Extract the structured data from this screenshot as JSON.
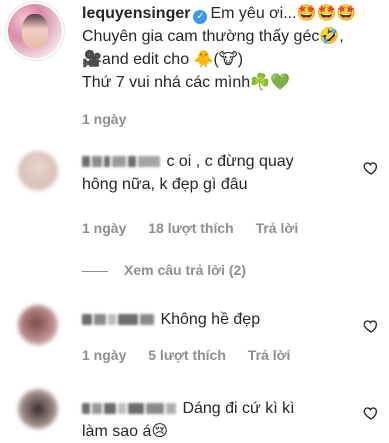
{
  "post": {
    "username": "lequyensinger",
    "caption_line1": "Em yêu ơi...🤩🤩🤩",
    "caption_line2": "Chuyên gia cam thường thấy géc🤣,",
    "caption_line3": "🎥and edit cho 🐥(🐮)",
    "caption_line4": "Thứ 7 vui nhá các mình☘️💚",
    "time": "1 ngày"
  },
  "comments": [
    {
      "text_line1": "c oi , c đừng quay",
      "text_line2": "hông nữa, k đẹp gì đâu",
      "time": "1 ngày",
      "likes": "18 lượt thích",
      "reply": "Trả lời",
      "view_replies": "Xem câu trả lời (2)"
    },
    {
      "text_line1": "Không hề đẹp",
      "time": "1 ngày",
      "likes": "5 lượt thích",
      "reply": "Trả lời"
    },
    {
      "text_line1": "Dáng đi cứ kì kì",
      "text_line2": "làm sao á😢"
    }
  ],
  "icons": {
    "verified": "verified-badge-icon",
    "heart": "heart-outline-icon"
  },
  "colors": {
    "text": "#262626",
    "meta": "#8e8e8e",
    "verified": "#3897f0"
  }
}
